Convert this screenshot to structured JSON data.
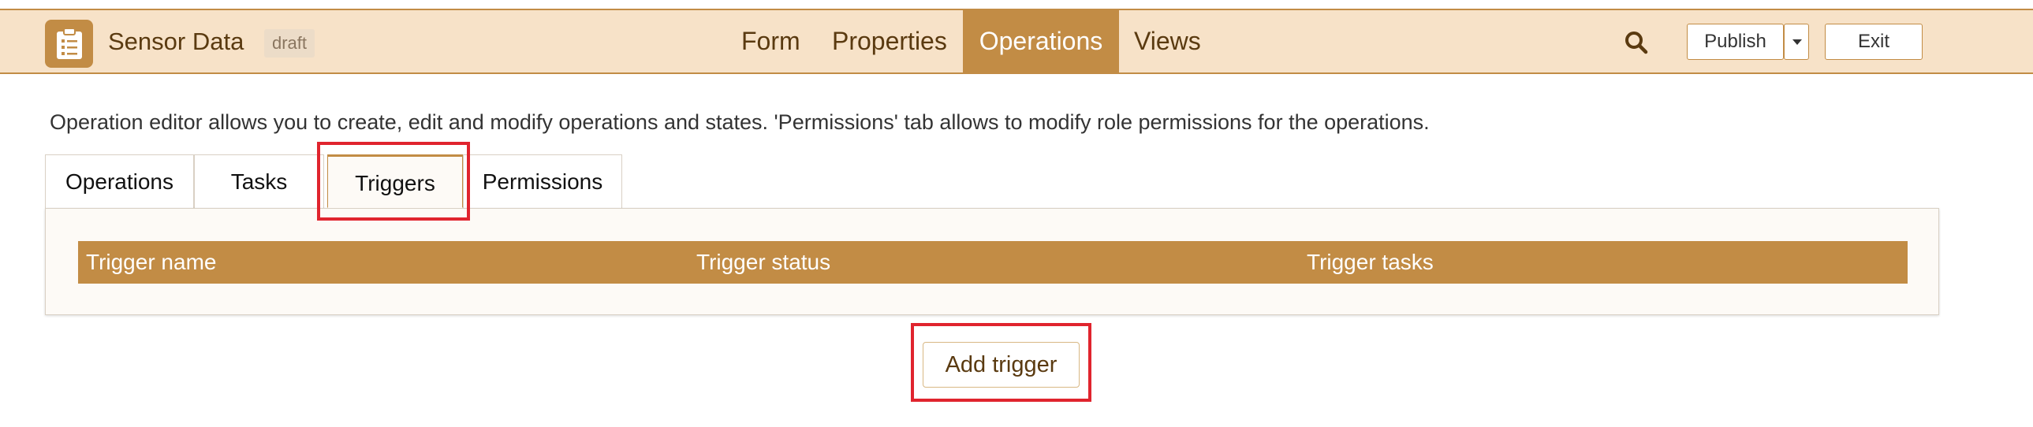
{
  "app": {
    "title": "Sensor Data",
    "status_badge": "draft"
  },
  "nav": {
    "items": [
      {
        "label": "Form"
      },
      {
        "label": "Properties"
      },
      {
        "label": "Operations",
        "active": true
      },
      {
        "label": "Views"
      }
    ]
  },
  "toolbar": {
    "publish_label": "Publish",
    "exit_label": "Exit"
  },
  "description": "Operation editor allows you to create, edit and modify operations and states. 'Permissions' tab allows to modify role permissions for the operations.",
  "subtabs": [
    {
      "label": "Operations"
    },
    {
      "label": "Tasks"
    },
    {
      "label": "Triggers",
      "active": true
    },
    {
      "label": "Permissions"
    }
  ],
  "table": {
    "columns": [
      "Trigger name",
      "Trigger status",
      "Trigger tasks"
    ],
    "rows": []
  },
  "actions": {
    "add_trigger_label": "Add trigger"
  },
  "colors": {
    "accent": "#c28c45",
    "topbar_bg": "#f7e2c8",
    "highlight": "#e0242e"
  },
  "icons": {
    "app": "clipboard-list-icon",
    "search": "search-icon",
    "dropdown": "caret-down-icon"
  }
}
